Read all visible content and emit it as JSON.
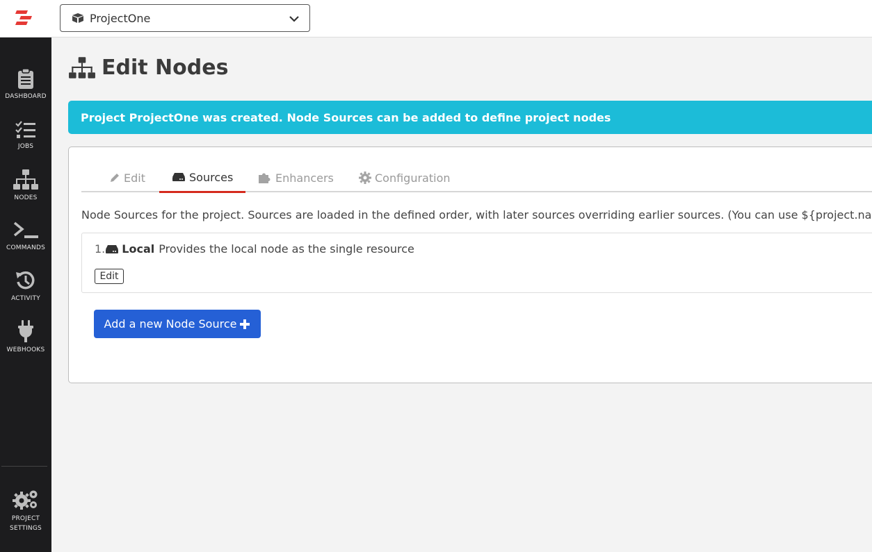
{
  "header": {
    "project_select": {
      "value": "ProjectOne"
    }
  },
  "sidebar": {
    "items": [
      {
        "label": "DASHBOARD",
        "icon": "clipboard-icon"
      },
      {
        "label": "JOBS",
        "icon": "tasks-icon"
      },
      {
        "label": "NODES",
        "icon": "sitemap-icon"
      },
      {
        "label": "COMMANDS",
        "icon": "terminal-icon"
      },
      {
        "label": "ACTIVITY",
        "icon": "history-icon"
      },
      {
        "label": "WEBHOOKS",
        "icon": "plug-icon"
      }
    ],
    "settings": {
      "label_line1": "PROJECT",
      "label_line2": "SETTINGS",
      "icon": "cogs-icon"
    }
  },
  "page": {
    "title": "Edit Nodes",
    "alert": "Project ProjectOne was created. Node Sources can be added to define project nodes"
  },
  "tabs": [
    {
      "label": "Edit",
      "icon": "pencil-icon",
      "active": false
    },
    {
      "label": "Sources",
      "icon": "hdd-icon",
      "active": true
    },
    {
      "label": "Enhancers",
      "icon": "puzzle-icon",
      "active": false
    },
    {
      "label": "Configuration",
      "icon": "gear-icon",
      "active": false
    }
  ],
  "sources": {
    "description": "Node Sources for the project. Sources are loaded in the defined order, with later sources overriding earlier sources. (You can use ${project.name} inside",
    "items": [
      {
        "number": "1.",
        "name": "Local",
        "description": "Provides the local node as the single resource",
        "edit_label": "Edit"
      }
    ],
    "add_button": "Add a new Node Source"
  },
  "colors": {
    "sidebar_bg": "#1c1c1e",
    "alert_bg": "#1cbcd8",
    "active_tab_underline": "#d52b1e",
    "primary_button": "#2560d6",
    "logo_red": "#e53935"
  }
}
